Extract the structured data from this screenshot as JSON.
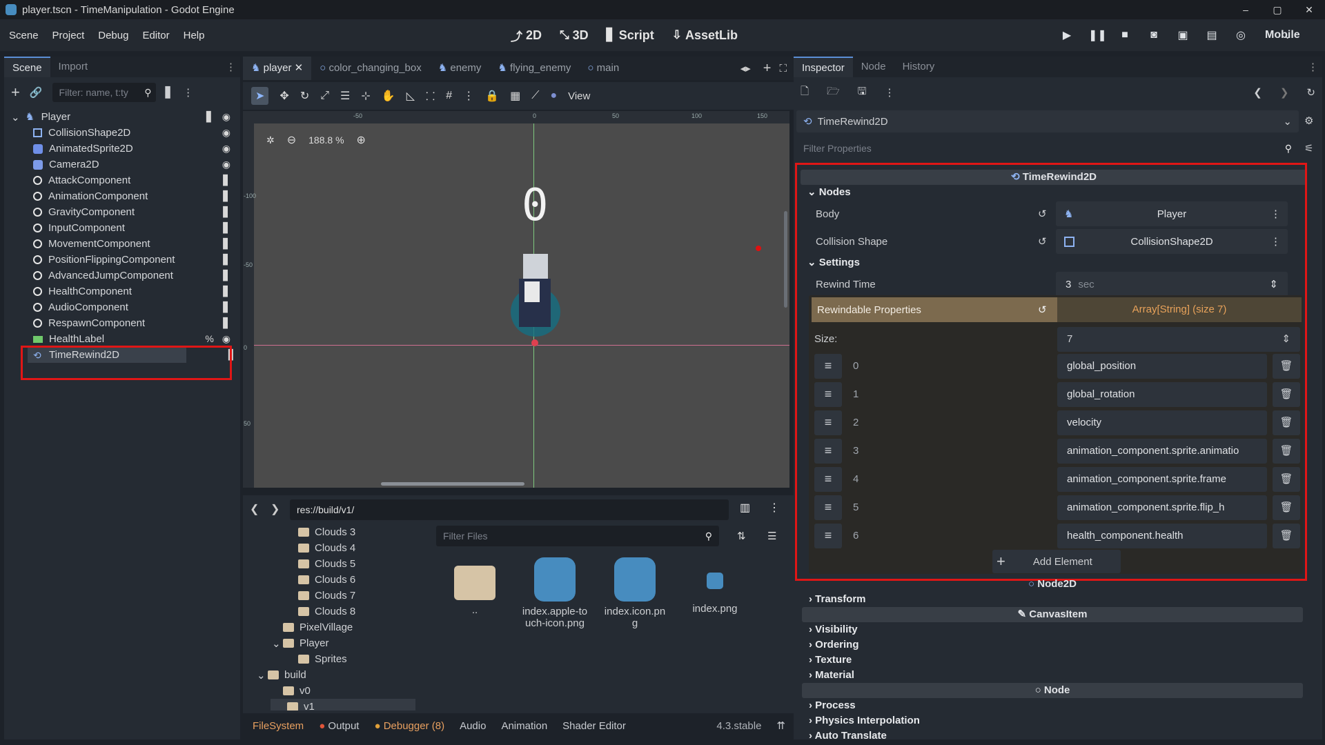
{
  "window": {
    "title": "player.tscn - TimeManipulation - Godot Engine",
    "controls": [
      "–",
      "▢",
      "✕"
    ]
  },
  "menu": [
    "Scene",
    "Project",
    "Debug",
    "Editor",
    "Help"
  ],
  "workspaces": [
    {
      "label": "2D",
      "icon": "2d-icon"
    },
    {
      "label": "3D",
      "icon": "3d-icon"
    },
    {
      "label": "Script",
      "icon": "script-icon"
    },
    {
      "label": "AssetLib",
      "icon": "assetlib-icon"
    }
  ],
  "renderer": "Mobile",
  "scene_dock": {
    "tabs": [
      "Scene",
      "Import"
    ],
    "filter_placeholder": "Filter: name, t:ty",
    "nodes": [
      {
        "name": "Player",
        "icon": "player-icon",
        "depth": 0,
        "script": true,
        "visible": true
      },
      {
        "name": "CollisionShape2D",
        "icon": "collision-shape-icon",
        "depth": 1,
        "visible": true
      },
      {
        "name": "AnimatedSprite2D",
        "icon": "animated-sprite-icon",
        "depth": 1,
        "visible": true
      },
      {
        "name": "Camera2D",
        "icon": "camera-icon",
        "depth": 1,
        "visible": true
      },
      {
        "name": "AttackComponent",
        "icon": "node-icon",
        "depth": 1,
        "script": true
      },
      {
        "name": "AnimationComponent",
        "icon": "node-icon",
        "depth": 1,
        "script": true
      },
      {
        "name": "GravityComponent",
        "icon": "node-icon",
        "depth": 1,
        "script": true
      },
      {
        "name": "InputComponent",
        "icon": "node-icon",
        "depth": 1,
        "script": true
      },
      {
        "name": "MovementComponent",
        "icon": "node-icon",
        "depth": 1,
        "script": true
      },
      {
        "name": "PositionFlippingComponent",
        "icon": "node-icon",
        "depth": 1,
        "script": true
      },
      {
        "name": "AdvancedJumpComponent",
        "icon": "node-icon",
        "depth": 1,
        "script": true
      },
      {
        "name": "HealthComponent",
        "icon": "node-icon",
        "depth": 1,
        "script": true
      },
      {
        "name": "AudioComponent",
        "icon": "node-icon",
        "depth": 1,
        "script": true
      },
      {
        "name": "RespawnComponent",
        "icon": "node-icon",
        "depth": 1,
        "script": true
      },
      {
        "name": "HealthLabel",
        "icon": "label-icon",
        "depth": 1,
        "visible": true,
        "extra": "%"
      },
      {
        "name": "TimeRewind2D",
        "icon": "time-rewind-icon",
        "depth": 1,
        "script": true,
        "visible": true,
        "selected": true
      }
    ]
  },
  "scene_tabs": [
    {
      "label": "player",
      "icon": "player-icon",
      "active": true
    },
    {
      "label": "color_changing_box",
      "icon": "node-icon"
    },
    {
      "label": "enemy",
      "icon": "player-icon"
    },
    {
      "label": "flying_enemy",
      "icon": "player-icon"
    },
    {
      "label": "main",
      "icon": "node-icon"
    }
  ],
  "canvas": {
    "view_label": "View",
    "zoom": "188.8 %",
    "ruler_labels": [
      "-50",
      "0",
      "50",
      "100",
      "150"
    ],
    "ruler_v_labels": [
      "-100",
      "-50",
      "0",
      "50"
    ],
    "score_text": "0"
  },
  "filesystem": {
    "path": "res://build/v1/",
    "filter_placeholder": "Filter Files",
    "tree": [
      {
        "name": "Clouds 3",
        "depth": 2
      },
      {
        "name": "Clouds 4",
        "depth": 2
      },
      {
        "name": "Clouds 5",
        "depth": 2
      },
      {
        "name": "Clouds 6",
        "depth": 2
      },
      {
        "name": "Clouds 7",
        "depth": 2
      },
      {
        "name": "Clouds 8",
        "depth": 2
      },
      {
        "name": "PixelVillage",
        "depth": 1
      },
      {
        "name": "Player",
        "depth": 1,
        "expanded": true
      },
      {
        "name": "Sprites",
        "depth": 2
      },
      {
        "name": "build",
        "depth": 0,
        "expanded": true
      },
      {
        "name": "v0",
        "depth": 1
      },
      {
        "name": "v1",
        "depth": 1,
        "selected": true
      }
    ],
    "files": [
      "..",
      "index.apple-touch-icon.png",
      "index.icon.png",
      "index.png"
    ]
  },
  "bottom_tabs": [
    "FileSystem",
    "Output",
    "Debugger (8)",
    "Audio",
    "Animation",
    "Shader Editor"
  ],
  "version": "4.3.stable",
  "inspector": {
    "tabs": [
      "Inspector",
      "Node",
      "History"
    ],
    "object": "TimeRewind2D",
    "filter_placeholder": "Filter Properties",
    "class_header": "TimeRewind2D",
    "groups": {
      "nodes": "Nodes",
      "settings": "Settings"
    },
    "body": {
      "label": "Body",
      "value": "Player"
    },
    "collision_shape": {
      "label": "Collision Shape",
      "value": "CollisionShape2D"
    },
    "rewind_time": {
      "label": "Rewind Time",
      "value": "3",
      "unit": "sec"
    },
    "rewindable": {
      "label": "Rewindable Properties",
      "value": "Array[String] (size 7)",
      "size_label": "Size:",
      "size": "7"
    },
    "elements": [
      "global_position",
      "global_rotation",
      "velocity",
      "animation_component.sprite.animatio",
      "animation_component.sprite.frame",
      "animation_component.sprite.flip_h",
      "health_component.health"
    ],
    "add_element": "Add Element",
    "node2d": "Node2D",
    "transform": "Transform",
    "canvas_item": "CanvasItem",
    "canvas_groups": [
      "Visibility",
      "Ordering",
      "Texture",
      "Material"
    ],
    "node": "Node",
    "node_groups": [
      "Process",
      "Physics Interpolation",
      "Auto Translate"
    ]
  }
}
